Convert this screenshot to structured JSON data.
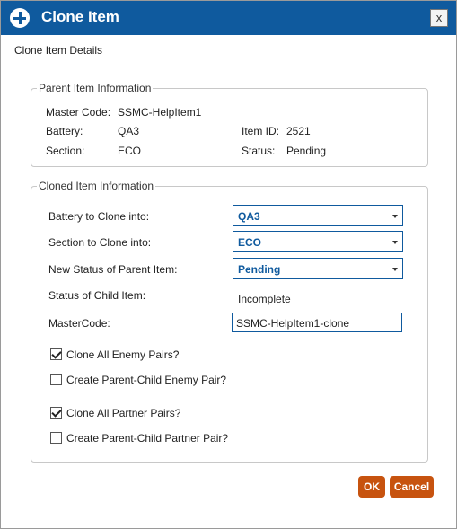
{
  "title": "Clone Item",
  "icons": {
    "title": "plus-circle-icon",
    "close": "close-icon",
    "dropdown": "chevron-down-icon",
    "checkbox_checked": "checkmark-icon"
  },
  "colors": {
    "titlebar": "#0f5a9e",
    "accent": "#0f5a9e",
    "button": "#c7530f"
  },
  "close_label": "x",
  "subtitle": "Clone Item Details",
  "parent": {
    "legend": "Parent Item Information",
    "master_code_label": "Master Code:",
    "master_code_value": "SSMC-HelpItem1",
    "battery_label": "Battery:",
    "battery_value": "QA3",
    "item_id_label": "Item ID:",
    "item_id_value": "2521",
    "section_label": "Section:",
    "section_value": "ECO",
    "status_label": "Status:",
    "status_value": "Pending"
  },
  "cloned": {
    "legend": "Cloned Item Information",
    "battery_label": "Battery to Clone into:",
    "battery_value": "QA3",
    "section_label": "Section to Clone into:",
    "section_value": "ECO",
    "new_status_label": "New Status of Parent Item:",
    "new_status_value": "Pending",
    "child_status_label": "Status of Child Item:",
    "child_status_value": "Incomplete",
    "master_code_label": "MasterCode:",
    "master_code_value": "SSMC-HelpItem1-clone",
    "checkboxes": [
      {
        "label": "Clone All Enemy Pairs?",
        "checked": true
      },
      {
        "label": "Create Parent-Child Enemy Pair?",
        "checked": false
      },
      {
        "label": "Clone All Partner Pairs?",
        "checked": true
      },
      {
        "label": "Create Parent-Child Partner Pair?",
        "checked": false
      }
    ]
  },
  "buttons": {
    "ok": "OK",
    "cancel": "Cancel"
  }
}
